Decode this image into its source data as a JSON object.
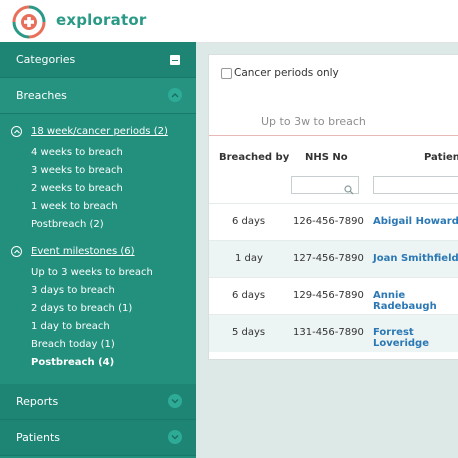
{
  "app": {
    "name": "explorator",
    "brand_color": "#2a9a86"
  },
  "sidebar": {
    "categories_label": "Categories",
    "breaches_label": "Breaches",
    "groups": [
      {
        "title": "18 week/cancer periods (2)",
        "items": [
          {
            "label": "4 weeks to breach",
            "bold": false
          },
          {
            "label": "3 weeks to breach",
            "bold": false
          },
          {
            "label": "2 weeks to breach",
            "bold": false
          },
          {
            "label": "1 week to breach",
            "bold": false
          },
          {
            "label": "Postbreach (2)",
            "bold": false
          }
        ]
      },
      {
        "title": "Event milestones (6)",
        "items": [
          {
            "label": "Up to 3 weeks to breach",
            "bold": false
          },
          {
            "label": "3 days to breach",
            "bold": false
          },
          {
            "label": "2 days to breach (1)",
            "bold": false
          },
          {
            "label": "1 day to breach",
            "bold": false
          },
          {
            "label": "Breach today (1)",
            "bold": false
          },
          {
            "label": "Postbreach (4)",
            "bold": true
          }
        ]
      }
    ],
    "reports_label": "Reports",
    "patients_label": "Patients"
  },
  "main": {
    "checkbox_label": "Cancer periods only",
    "tab_label": "Up to 3w to breach",
    "columns": [
      "Breached by",
      "NHS No",
      "Patient"
    ],
    "rows": [
      {
        "breached_by": "6 days",
        "nhs": "126-456-7890",
        "patient": "Abigail Howard"
      },
      {
        "breached_by": "1 day",
        "nhs": "127-456-7890",
        "patient": "Joan Smithfield"
      },
      {
        "breached_by": "6 days",
        "nhs": "129-456-7890",
        "patient": "Annie Radebaugh"
      },
      {
        "breached_by": "5 days",
        "nhs": "131-456-7890",
        "patient": "Forrest Loveridge"
      }
    ]
  },
  "colors": {
    "sidebar": "#23907e",
    "link": "#2b78b5",
    "accent_line": "#e8b8b4"
  },
  "icons": {
    "logo": "heart-cross-logo-icon",
    "collapse": "minus-square-icon",
    "chevron_up": "chevron-up-icon",
    "chevron_down": "chevron-down-icon",
    "search": "search-icon"
  }
}
